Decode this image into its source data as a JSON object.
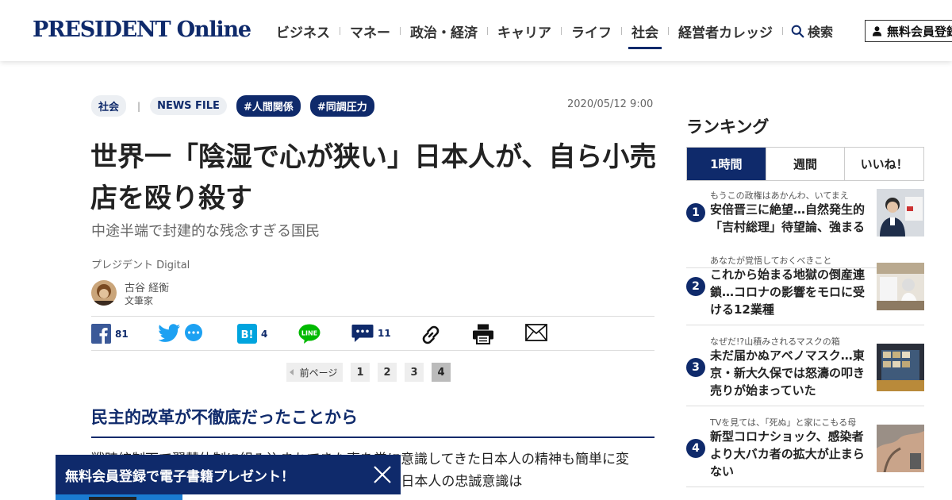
{
  "header": {
    "logo": "PRESIDENT Online",
    "nav": [
      "ビジネス",
      "マネー",
      "政治・経済",
      "キャリア",
      "ライフ",
      "社会",
      "経営者カレッジ"
    ],
    "active_nav": "社会",
    "search_label": "検索",
    "member_label": "無料会員登録"
  },
  "article": {
    "tags": [
      "社会",
      "NEWS FILE",
      "#人間関係",
      "#同調圧力"
    ],
    "date": "2020/05/12 9:00",
    "title": "世界一「陰湿で心が狭い」日本人が、自ら小売店を殴り殺す",
    "subtitle": "中途半端で封建的な残念すぎる国民",
    "source": "プレジデント Digital",
    "author_name": "古谷 経衡",
    "author_role": "文筆家",
    "share": {
      "facebook_count": "81",
      "hatena_count": "4",
      "comment_count": "11"
    },
    "pager": {
      "prev_label": "前ページ",
      "pages": [
        "1",
        "2",
        "3",
        "4"
      ],
      "current": "4"
    },
    "section_heading": "民主的改革が不徹底だったことから",
    "body_lines": [
      "戦時統制下で翼賛体制に組み込まれてきた事を常に意識してきた日本人の精神も簡単に変",
      "わるものではない。戦後の占領体制が一服すると、日本人の忠誠意識は"
    ]
  },
  "banner": {
    "text": "無料会員登録で電子書籍プレゼント！"
  },
  "ranking": {
    "title": "ランキング",
    "tabs": [
      "1時間",
      "週間",
      "いいね！"
    ],
    "active_tab": "1時間",
    "items": [
      {
        "rank": "1",
        "kicker": "もうこの政権はあかんわ、いてまえ",
        "headline": "安倍晋三に絶望…自然発生的「吉村総理」待望論、強まる"
      },
      {
        "rank": "2",
        "kicker": "あなたが覚悟しておくべきこと",
        "headline": "これから始まる地獄の倒産連鎖…コロナの影響をモロに受ける12業種"
      },
      {
        "rank": "3",
        "kicker": "なぜだ!?山積みされるマスクの箱",
        "headline": "未だ届かぬアベノマスク…東京・新大久保では怒濤の叩き売りが始まっていた"
      },
      {
        "rank": "4",
        "kicker": "TVを見ては、「死ぬ」と家にこもる母",
        "headline": "新型コロナショック、感染者より大バカ者の拡大が止まらない"
      }
    ]
  },
  "colors": {
    "brand": "#0f2a6b",
    "accent_blue": "#1a7bd1"
  }
}
